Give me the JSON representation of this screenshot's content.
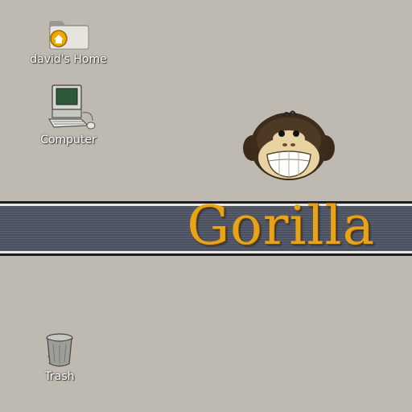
{
  "desktop": {
    "background_color": "#bebab1",
    "icons": [
      {
        "label": "david's Home",
        "icon": "home-folder-icon"
      },
      {
        "label": "Computer",
        "icon": "computer-icon"
      },
      {
        "label": "Trash",
        "icon": "trash-icon"
      }
    ]
  },
  "wallpaper": {
    "brand_name": "Gorilla",
    "brand_color": "#e8a317",
    "banner_color": "#4d5260",
    "mascot": "gorilla-face-logo"
  }
}
